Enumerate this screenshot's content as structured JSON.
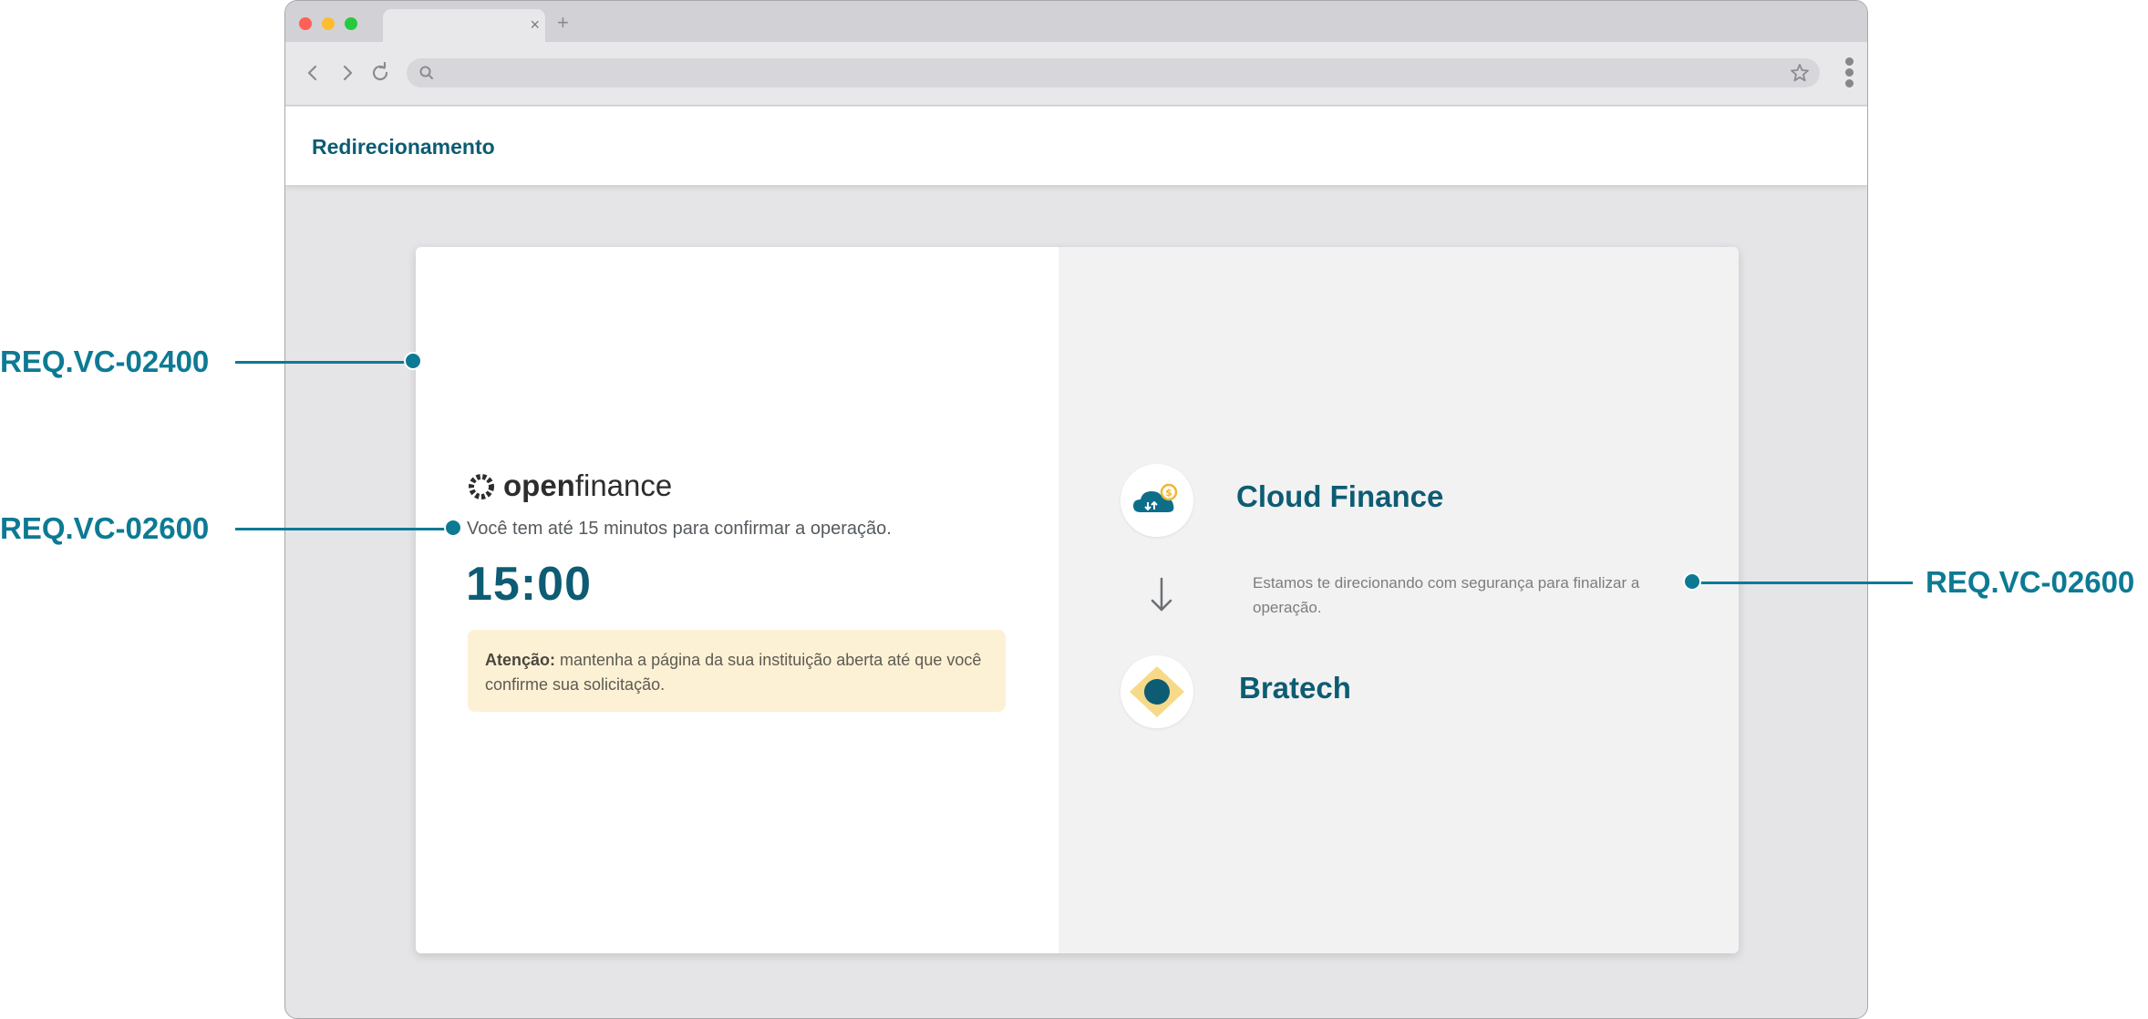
{
  "browser": {
    "tab_close": "×",
    "tab_new": "+"
  },
  "header": {
    "title": "Redirecionamento"
  },
  "left_panel": {
    "logo_bold": "open",
    "logo_light": "finance",
    "minutes_text": "Você tem até 15 minutos para confirmar a operação.",
    "timer": "15:00",
    "alert_bold": "Atenção:",
    "alert_text": "mantenha a página da sua instituição aberta até que você confirme sua solicitação."
  },
  "right_panel": {
    "source_institution": "Cloud Finance",
    "redirect_text": "Estamos te direcionando com segurança para finalizar a operação.",
    "target_institution": "Bratech"
  },
  "annotations": [
    {
      "label": "REQ.VC-02400"
    },
    {
      "label": "REQ.VC-02600"
    },
    {
      "label": "REQ.VC-02600"
    }
  ],
  "colors": {
    "brand": "#0d5c73",
    "annotation": "#0d7a94",
    "alert_bg": "#fdf1d5",
    "bratech_diamond": "#f7d98a"
  }
}
